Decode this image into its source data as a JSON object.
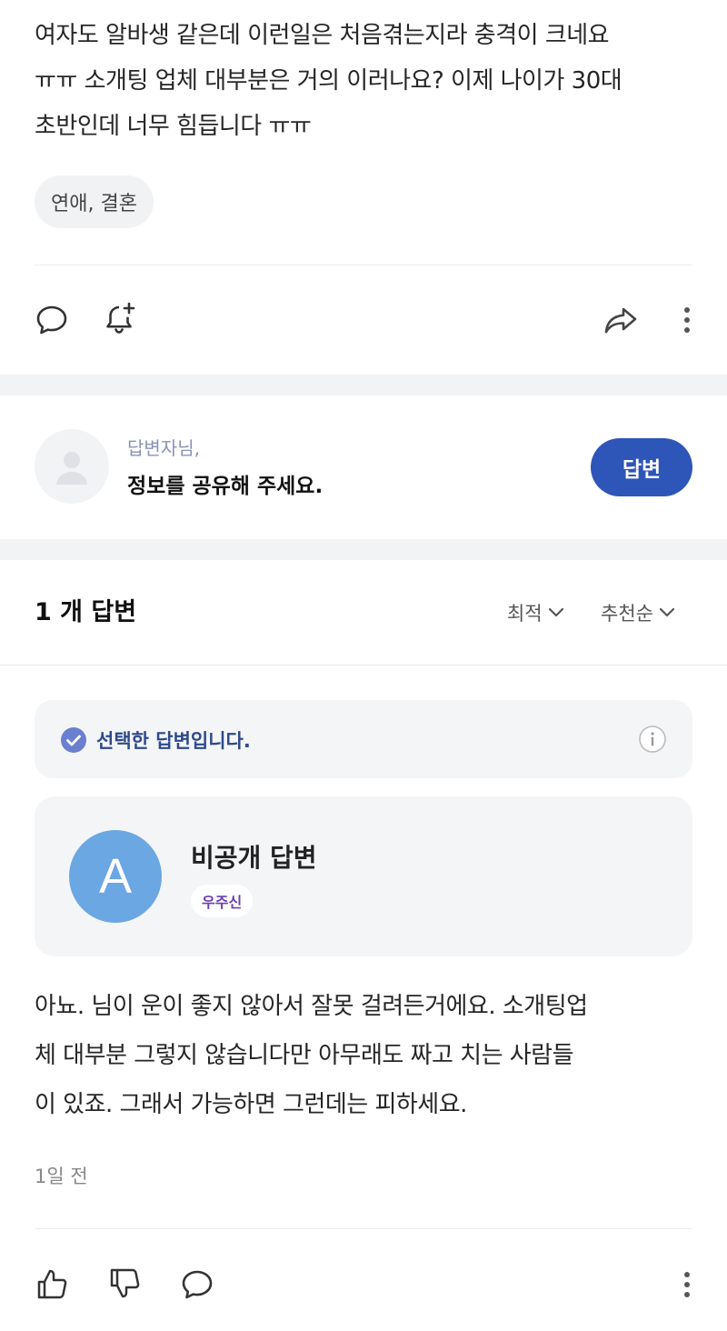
{
  "question": {
    "body_lines": [
      "여자도 알바생 같은데 이런일은 처음겪는지라 충격이 크네요",
      "ㅠㅠ 소개팅 업체 대부분은 거의 이러나요? 이제 나이가 30대",
      "초반인데 너무 힘듭니다 ㅠㅠ"
    ],
    "tag": "연애, 결혼",
    "actions": {
      "comment_icon": "speech-bubble-icon",
      "alert_icon": "bell-plus-icon",
      "share_icon": "share-arrow-icon",
      "more_icon": "vertical-ellipsis-icon"
    }
  },
  "answer_prompt": {
    "subtitle": "답변자님,",
    "title": "정보를 공유해 주세요.",
    "button_label": "답변",
    "avatar_icon": "default-user-icon"
  },
  "answers_section": {
    "count_label": "1 개 답변",
    "sort_options": [
      "최적",
      "추천순"
    ]
  },
  "selected_answer": {
    "banner_label": "선택한 답변입니다.",
    "author_initial": "A",
    "author_name": "비공개 답변",
    "author_badge": "우주신",
    "body_lines": [
      "아뇨. 님이 운이 좋지 않아서 잘못 걸려든거에요. 소개팅업",
      "체 대부분 그렇지 않습니다만 아무래도 짜고 치는 사람들",
      "이 있죠. 그래서 가능하면 그런데는 피하세요."
    ],
    "time_ago": "1일 전",
    "actions": {
      "like_icon": "thumbs-up-icon",
      "dislike_icon": "thumbs-down-icon",
      "comment_icon": "speech-bubble-icon",
      "more_icon": "vertical-ellipsis-icon"
    }
  },
  "colors": {
    "accent": "#2e55b8",
    "band": "#f2f3f5",
    "avatar": "#6aa7e3",
    "badge_text": "#6a3fb2",
    "selected_text": "#2f4a8a"
  }
}
